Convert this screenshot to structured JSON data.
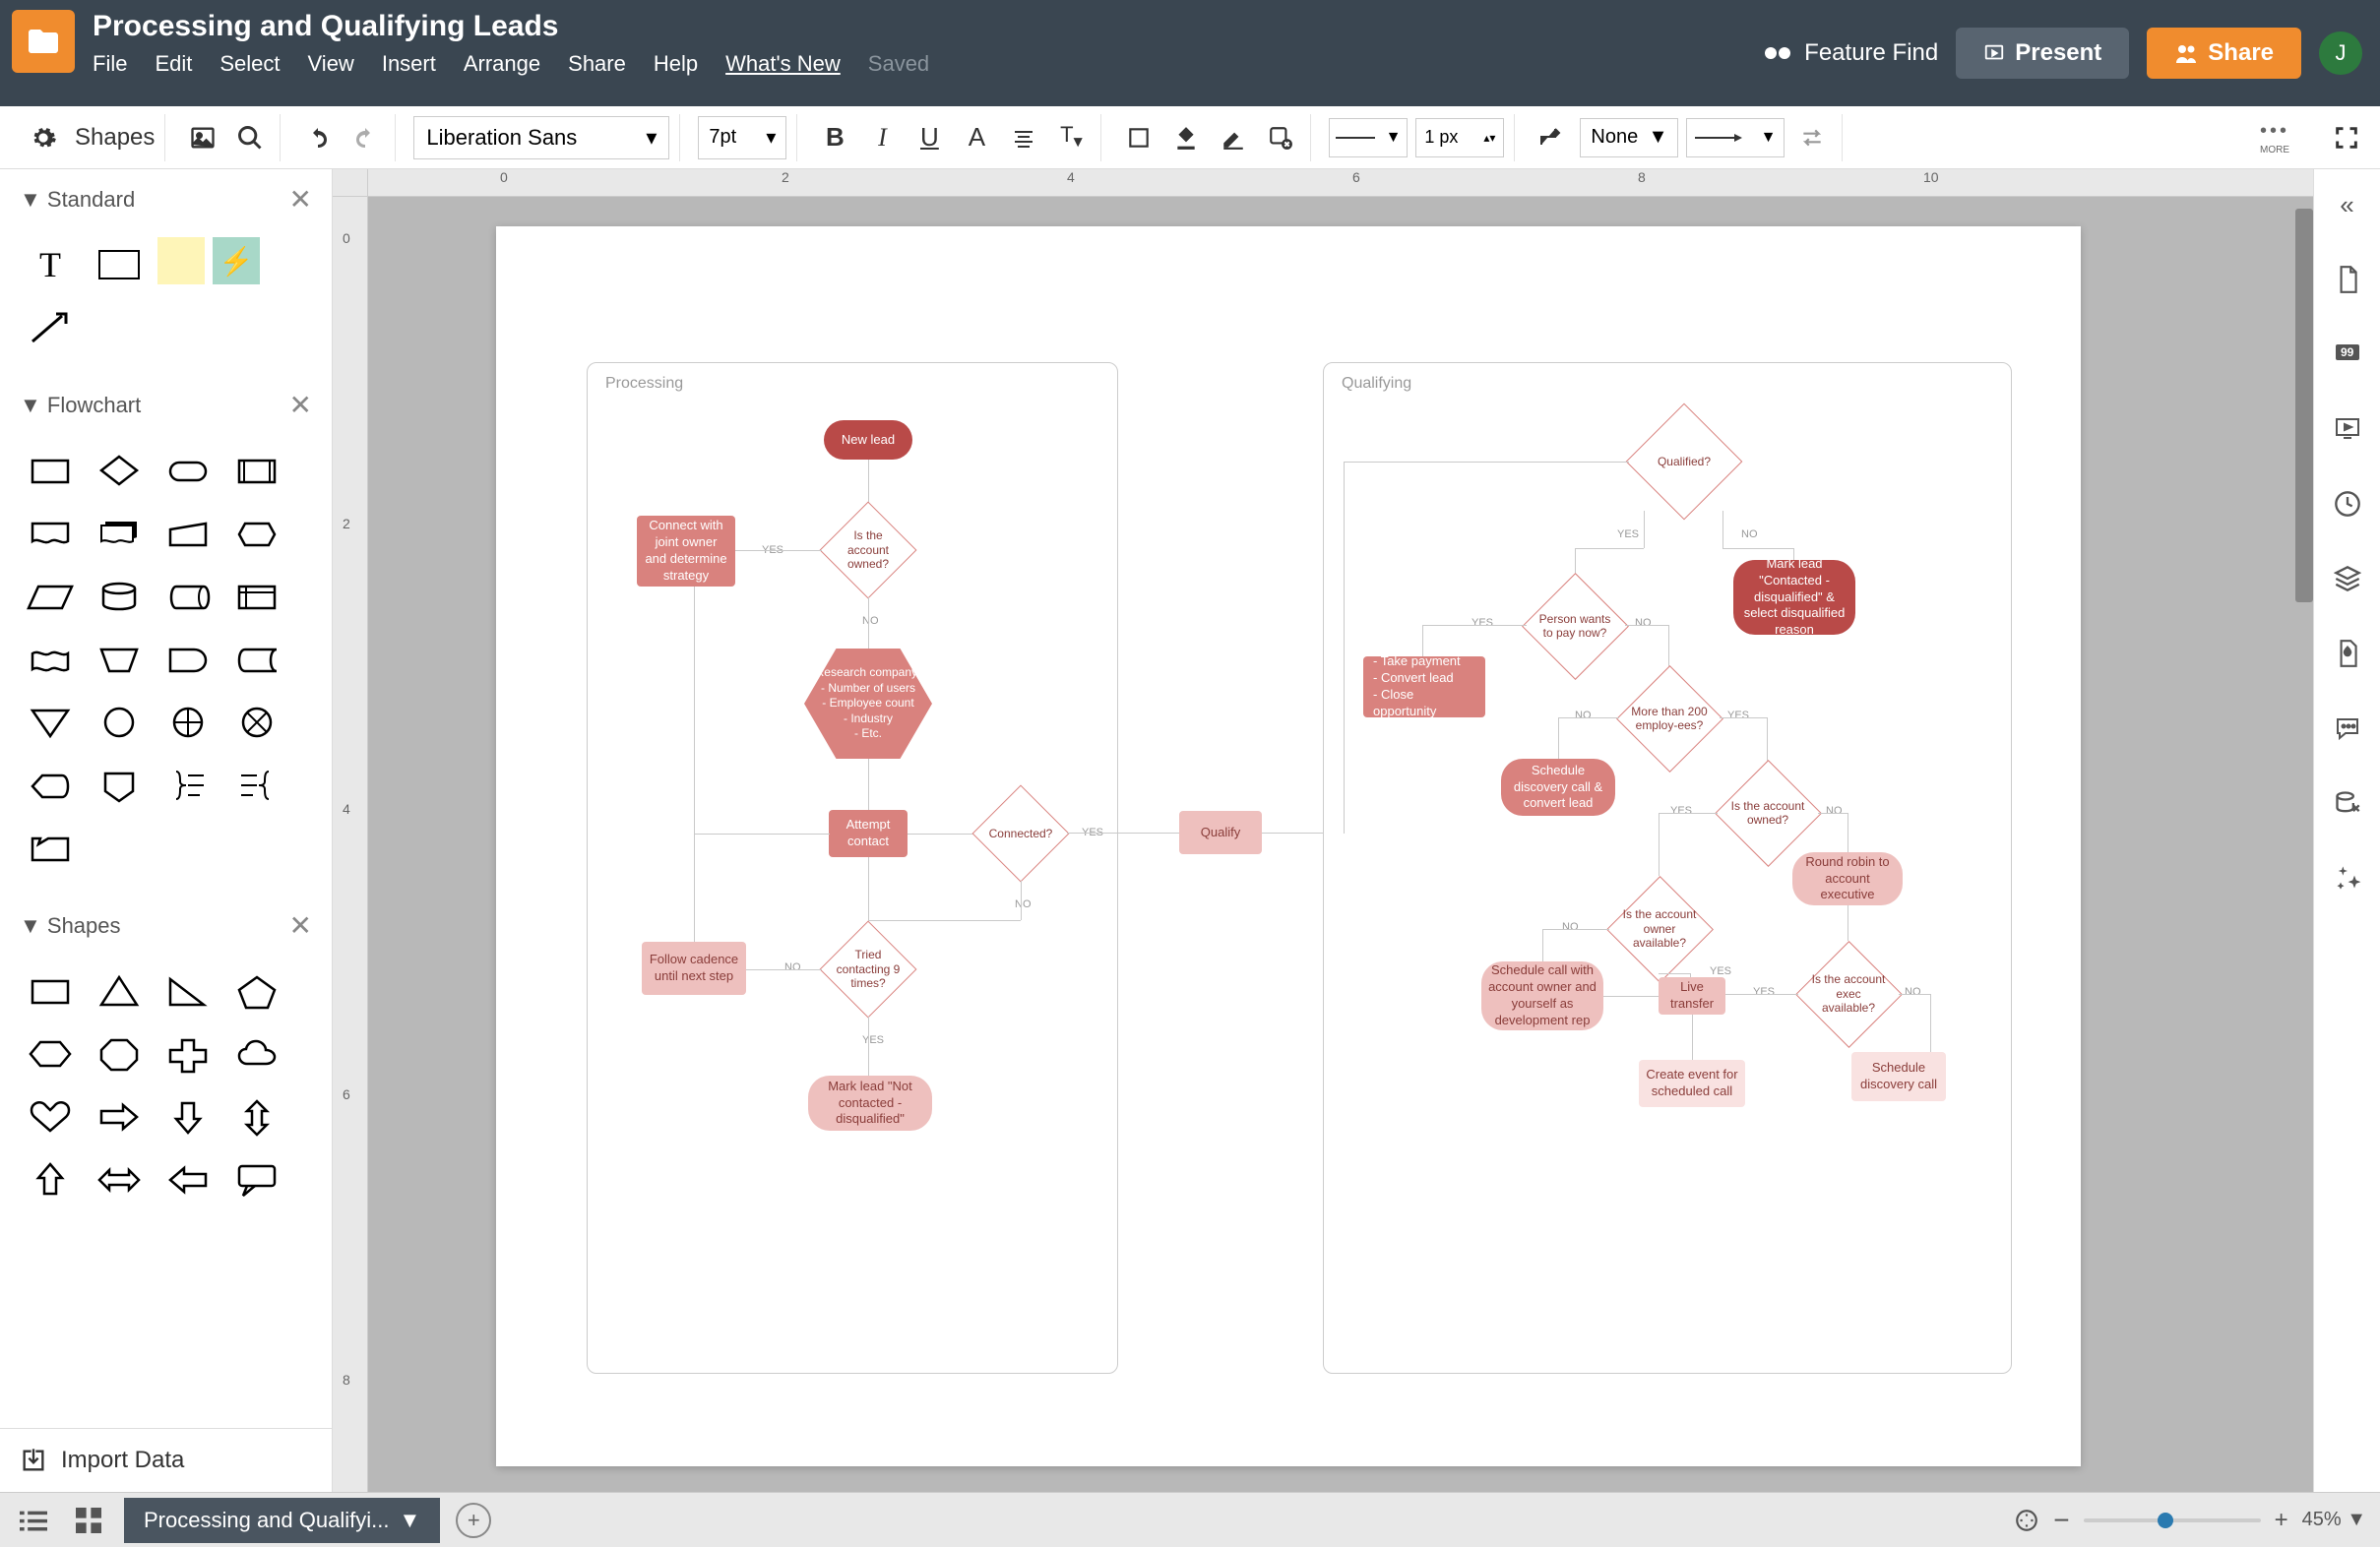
{
  "doc": {
    "title": "Processing and Qualifying Leads",
    "saved": "Saved"
  },
  "menu": [
    "File",
    "Edit",
    "Select",
    "View",
    "Insert",
    "Arrange",
    "Share",
    "Help",
    "What's New"
  ],
  "header": {
    "feature_find": "Feature Find",
    "present": "Present",
    "share": "Share",
    "avatar": "J"
  },
  "toolbar": {
    "shapes_label": "Shapes",
    "font": "Liberation Sans",
    "font_size": "7pt",
    "line_width": "1 px",
    "fill": "None",
    "more": "MORE"
  },
  "sidebar": {
    "sections": [
      "Standard",
      "Flowchart",
      "Shapes"
    ],
    "import": "Import Data"
  },
  "footer": {
    "tab": "Processing and Qualifyi...",
    "zoom": "45%"
  },
  "ruler_h": [
    "0",
    "2",
    "4",
    "6",
    "8",
    "10"
  ],
  "ruler_v": [
    "0",
    "2",
    "4",
    "6",
    "8"
  ],
  "flowchart": {
    "frames": {
      "processing": "Processing",
      "qualifying": "Qualifying"
    },
    "nodes": {
      "new_lead": "New lead",
      "account_owned1": "Is the account owned?",
      "connect_owner": "Connect with joint owner and determine strategy",
      "research": "Research company:\n- Number of users\n- Employee count\n- Industry\n- Etc.",
      "attempt_contact": "Attempt contact",
      "connected": "Connected?",
      "qualify": "Qualify",
      "tried9": "Tried contacting 9 times?",
      "follow_cadence": "Follow cadence until next step",
      "not_contacted": "Mark lead \"Not contacted - disqualified\"",
      "qualified": "Qualified?",
      "pay_now": "Person wants to pay now?",
      "mark_dq": "Mark lead \"Contacted - disqualified\" & select disqualified reason",
      "take_payment": "- Take payment\n- Convert lead\n- Close opportunity",
      "more200": "More than 200 employ-ees?",
      "schedule_discovery": "Schedule discovery call & convert lead",
      "account_owned2": "Is the account owned?",
      "owner_avail": "Is the account owner available?",
      "round_robin": "Round robin to account executive",
      "exec_avail": "Is the account exec available?",
      "schedule_call_owner": "Schedule call with account owner and yourself as development rep",
      "live_transfer": "Live transfer",
      "create_event": "Create event for scheduled call",
      "schedule_disc2": "Schedule discovery call"
    },
    "labels": {
      "yes": "YES",
      "no": "NO"
    }
  }
}
